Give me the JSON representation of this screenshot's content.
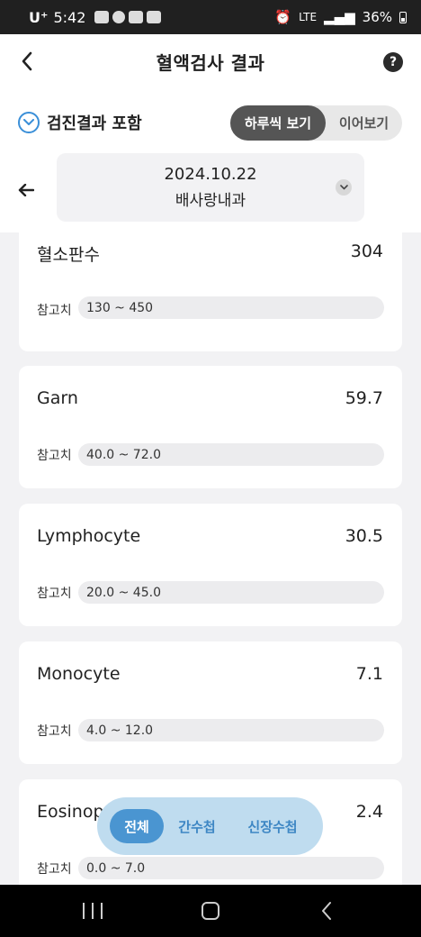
{
  "status_bar": {
    "carrier": "U⁺",
    "time": "5:42",
    "network": "LTE",
    "battery": "36%"
  },
  "header": {
    "title": "혈액검사 결과",
    "help_label": "?"
  },
  "filter": {
    "include_label": "검진결과 포함",
    "view_options": [
      "하루씩 보기",
      "이어보기"
    ],
    "selected_view": "하루씩 보기"
  },
  "date_selector": {
    "date": "2024.10.22",
    "department": "배사랑내과"
  },
  "results": [
    {
      "name": "혈소판수",
      "value": "304",
      "ref_label": "참고치",
      "ref_range": "130 ~ 450"
    },
    {
      "name": "Garn",
      "value": "59.7",
      "ref_label": "참고치",
      "ref_range": "40.0 ~ 72.0"
    },
    {
      "name": "Lymphocyte",
      "value": "30.5",
      "ref_label": "참고치",
      "ref_range": "20.0 ~ 45.0"
    },
    {
      "name": "Monocyte",
      "value": "7.1",
      "ref_label": "참고치",
      "ref_range": "4.0 ~ 12.0"
    },
    {
      "name": "Eosinop",
      "value": "2.4",
      "ref_label": "참고치",
      "ref_range": "0.0 ~ 7.0"
    }
  ],
  "categories": {
    "items": [
      "전체",
      "간수첩",
      "신장수첩"
    ],
    "selected": "전체"
  },
  "colors": {
    "accent": "#4a95d1",
    "category_bg": "#bfdcef",
    "toggle_active": "#555555",
    "page_bg": "#f2f2f4"
  }
}
